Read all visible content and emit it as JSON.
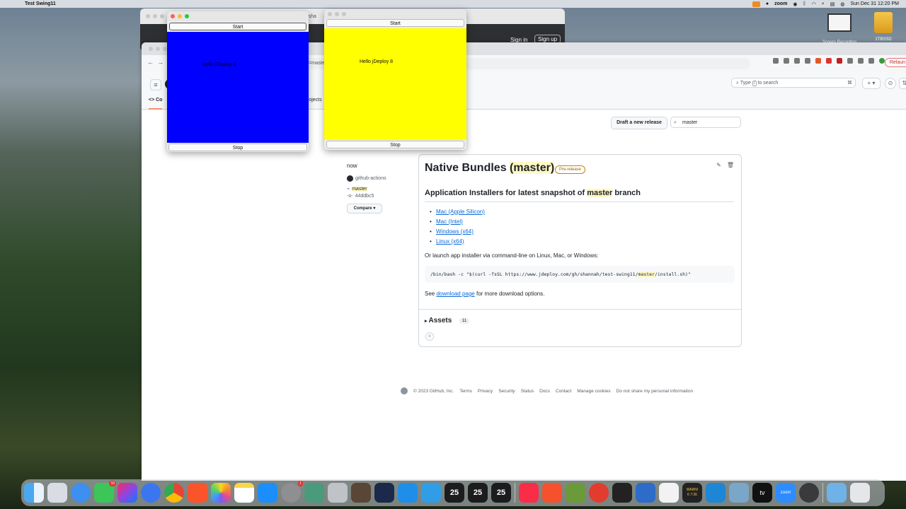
{
  "menubar": {
    "app_name": "Test Swing11",
    "zoom_label": "zoom",
    "datetime": "Sun Dec 31  12:20 PM"
  },
  "desktop": {
    "icons": [
      {
        "label": "Screen Recording"
      },
      {
        "label": "1TBSSD"
      }
    ]
  },
  "browser": {
    "url_fragment": "=maste",
    "url_fragment_back": "om/sha",
    "relaunch_label": "Relaun",
    "back_signin": "Sign in",
    "back_signup": "Sign up",
    "search_prefix": "Type",
    "search_key": "/",
    "search_suffix": "to search",
    "plus_label": "+ ▾",
    "tab_code": "Co",
    "tab_projects": "rojects"
  },
  "release": {
    "draft_button": "Draft a new release",
    "filter_value": "master",
    "when": "now",
    "author": "github-actions",
    "tag": "master",
    "commit": "44ddbc5",
    "compare_button": "Compare",
    "title_prefix": "Native Bundles ",
    "title_tag": "(master)",
    "badge": "Pre-release",
    "heading_prefix": "Application Installers for latest snapshot of ",
    "heading_tag": "master",
    "heading_suffix": " branch",
    "links": [
      "Mac (Apple Silicon)",
      "Mac (Intel)",
      "Windows (x64)",
      "Linux (x64)"
    ],
    "cli_text": "Or launch app installer via command-line on Linux, Mac, or Windows:",
    "code_prefix": "/bin/bash -c \"$(curl -fsSL https://www.jdeploy.com/gh/shannah/test-swing11/",
    "code_tag": "master",
    "code_suffix": "/install.sh)\"",
    "see_prefix": "See ",
    "see_link": "download page",
    "see_suffix": " for more download options.",
    "assets_label": "Assets",
    "assets_count": "11"
  },
  "footer": {
    "copyright": "© 2023 GitHub, Inc.",
    "links": [
      "Terms",
      "Privacy",
      "Security",
      "Status",
      "Docs",
      "Contact",
      "Manage cookies",
      "Do not share my personal information"
    ]
  },
  "swing_blue": {
    "start_label": "Start",
    "stop_label": "Stop",
    "hello_label": "Hello jDeploy 8",
    "panel_color": "#0000ff"
  },
  "swing_yellow": {
    "start_label": "Start",
    "stop_label": "Stop",
    "hello_label": "Hello jDeploy 8",
    "panel_color": "#ffff00"
  },
  "dock": {
    "messages_badge": "10",
    "settings_badge": "1",
    "date_tiles": [
      "25",
      "25",
      "25"
    ],
    "warn_tile": "WARN!",
    "warn_time": "6 7:36",
    "tv_label": "tv",
    "zoom_label": "zoom"
  }
}
